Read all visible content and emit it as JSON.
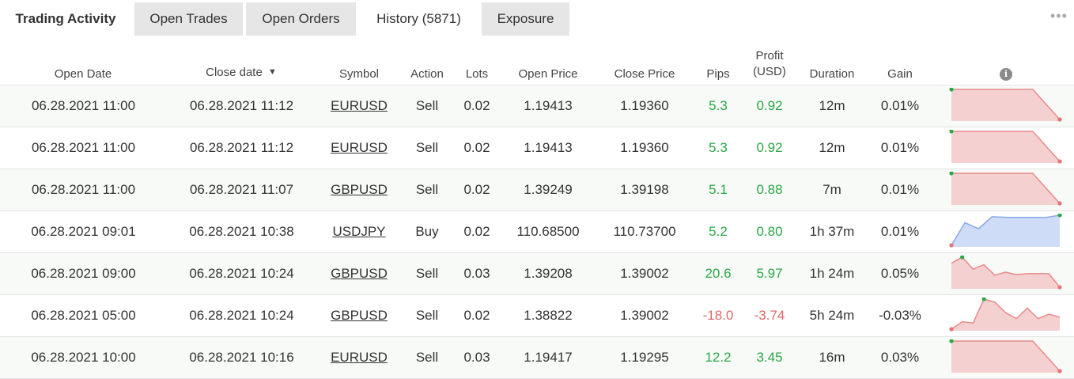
{
  "tabs": {
    "title": "Trading Activity",
    "items": [
      {
        "label": "Open Trades"
      },
      {
        "label": "Open Orders"
      },
      {
        "label": "History (5871)"
      },
      {
        "label": "Exposure"
      }
    ],
    "active": "History (5871)",
    "more_icon": "more-horizontal-icon"
  },
  "table": {
    "headers": {
      "open_date": "Open Date",
      "close_date": "Close date",
      "sort_indicator": "▼",
      "symbol": "Symbol",
      "action": "Action",
      "lots": "Lots",
      "open_price": "Open Price",
      "close_price": "Close Price",
      "pips": "Pips",
      "profit_line1": "Profit",
      "profit_line2": "(USD)",
      "duration": "Duration",
      "gain": "Gain",
      "info_icon": "info-icon"
    },
    "rows": [
      {
        "open_date": "06.28.2021 11:00",
        "close_date": "06.28.2021 11:12",
        "symbol": "EURUSD",
        "action": "Sell",
        "lots": "0.02",
        "open_price": "1.19413",
        "close_price": "1.19360",
        "pips": "5.3",
        "profit": "0.92",
        "duration": "12m",
        "gain": "0.01%",
        "profitable": true,
        "chart": {
          "type": "area",
          "values": [
            1.0,
            1.0,
            1.0,
            1.0,
            0.0
          ],
          "color": "red"
        }
      },
      {
        "open_date": "06.28.2021 11:00",
        "close_date": "06.28.2021 11:12",
        "symbol": "EURUSD",
        "action": "Sell",
        "lots": "0.02",
        "open_price": "1.19413",
        "close_price": "1.19360",
        "pips": "5.3",
        "profit": "0.92",
        "duration": "12m",
        "gain": "0.01%",
        "profitable": true,
        "chart": {
          "type": "area",
          "values": [
            1.0,
            1.0,
            1.0,
            1.0,
            0.0
          ],
          "color": "red"
        }
      },
      {
        "open_date": "06.28.2021 11:00",
        "close_date": "06.28.2021 11:07",
        "symbol": "GBPUSD",
        "action": "Sell",
        "lots": "0.02",
        "open_price": "1.39249",
        "close_price": "1.39198",
        "pips": "5.1",
        "profit": "0.88",
        "duration": "7m",
        "gain": "0.01%",
        "profitable": true,
        "chart": {
          "type": "area",
          "values": [
            1.0,
            1.0,
            1.0,
            1.0,
            0.0
          ],
          "color": "red"
        }
      },
      {
        "open_date": "06.28.2021 09:01",
        "close_date": "06.28.2021 10:38",
        "symbol": "USDJPY",
        "action": "Buy",
        "lots": "0.02",
        "open_price": "110.68500",
        "close_price": "110.73700",
        "pips": "5.2",
        "profit": "0.80",
        "duration": "1h 37m",
        "gain": "0.01%",
        "profitable": true,
        "chart": {
          "type": "area",
          "values": [
            0.0,
            0.75,
            0.55,
            0.95,
            0.93,
            0.93,
            0.93,
            0.93,
            1.0
          ],
          "color": "blue"
        }
      },
      {
        "open_date": "06.28.2021 09:00",
        "close_date": "06.28.2021 10:24",
        "symbol": "GBPUSD",
        "action": "Sell",
        "lots": "0.03",
        "open_price": "1.39208",
        "close_price": "1.39002",
        "pips": "20.6",
        "profit": "5.97",
        "duration": "1h 24m",
        "gain": "0.05%",
        "profitable": true,
        "chart": {
          "type": "area",
          "values": [
            0.8,
            1.0,
            0.6,
            0.75,
            0.4,
            0.5,
            0.42,
            0.45,
            0.45,
            0.45,
            0.0
          ],
          "color": "red"
        }
      },
      {
        "open_date": "06.28.2021 05:00",
        "close_date": "06.28.2021 10:24",
        "symbol": "GBPUSD",
        "action": "Sell",
        "lots": "0.02",
        "open_price": "1.38822",
        "close_price": "1.39002",
        "pips": "-18.0",
        "profit": "-3.74",
        "duration": "5h 24m",
        "gain": "-0.03%",
        "profitable": false,
        "chart": {
          "type": "area",
          "values": [
            0.0,
            0.25,
            0.2,
            1.0,
            0.9,
            0.55,
            0.35,
            0.7,
            0.35,
            0.5,
            0.4
          ],
          "color": "red"
        }
      },
      {
        "open_date": "06.28.2021 10:00",
        "close_date": "06.28.2021 10:16",
        "symbol": "EURUSD",
        "action": "Sell",
        "lots": "0.03",
        "open_price": "1.19417",
        "close_price": "1.19295",
        "pips": "12.2",
        "profit": "3.45",
        "duration": "16m",
        "gain": "0.03%",
        "profitable": true,
        "chart": {
          "type": "area",
          "values": [
            1.0,
            1.0,
            1.0,
            1.0,
            0.0
          ],
          "color": "red"
        }
      }
    ]
  },
  "colors": {
    "positive": "#2aa845",
    "negative": "#e06666",
    "spark_red_fill": "#f5d0d0",
    "spark_red_line": "#e88a8a",
    "spark_blue_fill": "#cfdcf7",
    "spark_blue_line": "#8aa8e8",
    "dot_green": "#2aa845",
    "dot_red": "#e87373"
  }
}
